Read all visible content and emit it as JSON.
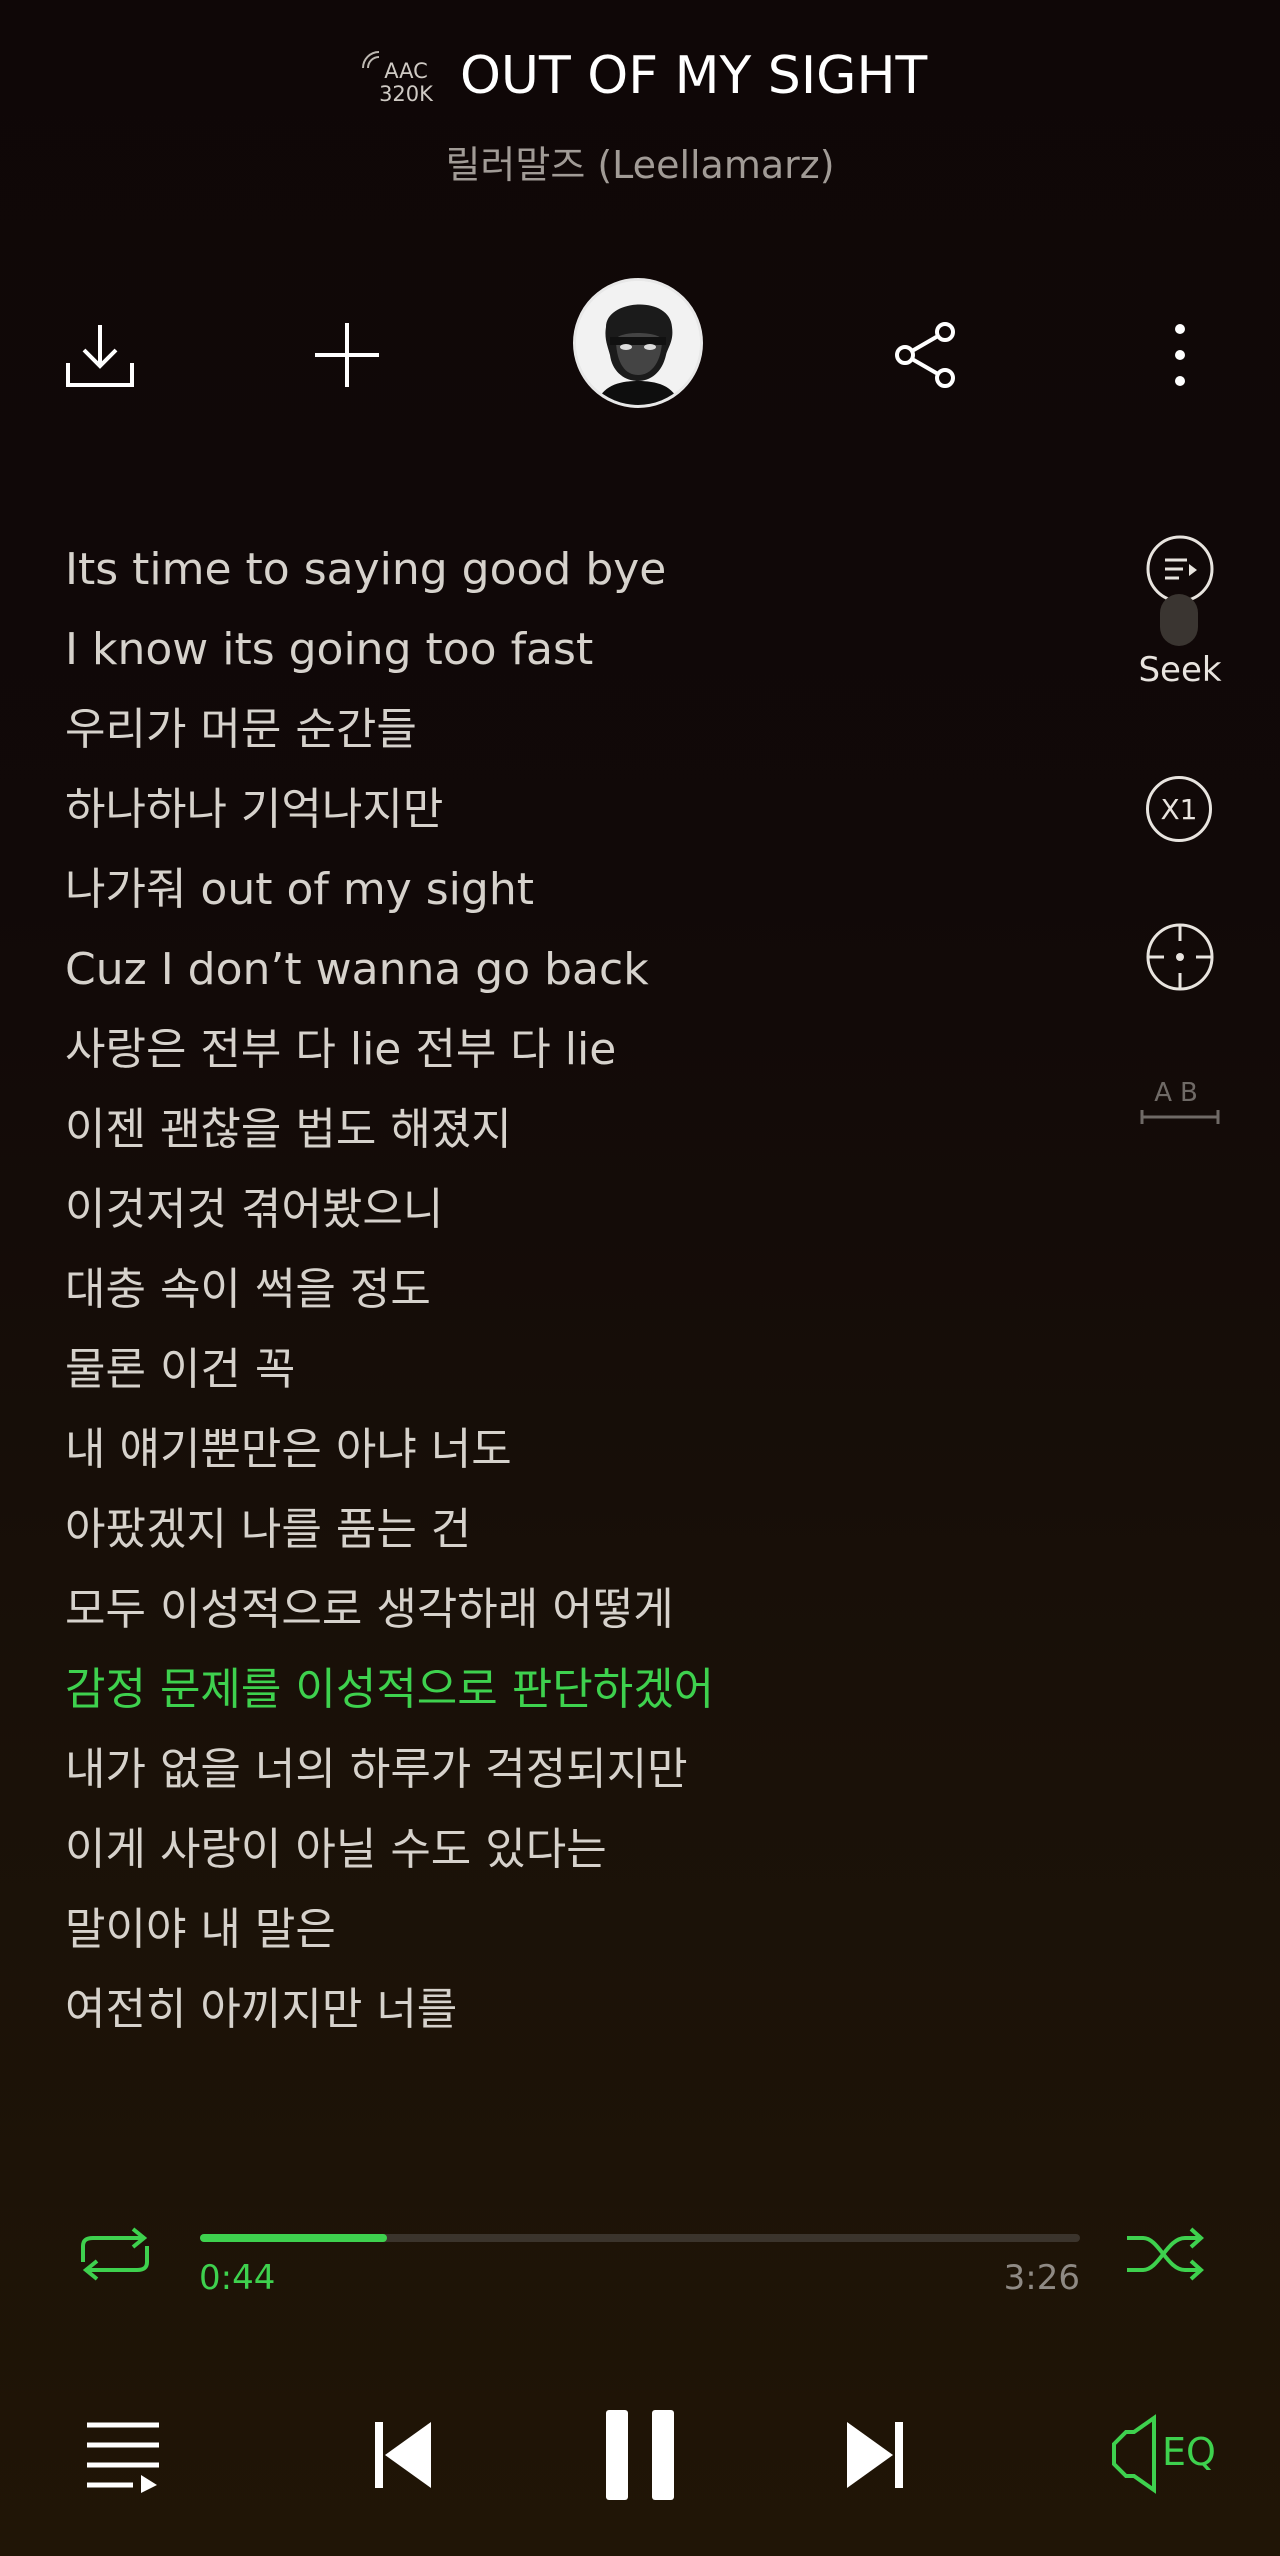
{
  "track": {
    "codec": "AAC",
    "bitrate": "320K",
    "title": "OUT OF MY SIGHT",
    "artist": "릴러말즈 (Leellamarz)"
  },
  "toolbar": {
    "download_icon": "download-icon",
    "add_icon": "plus-icon",
    "album_art": "album-art",
    "share_icon": "share-icon",
    "more_icon": "more-vertical-icon"
  },
  "lyrics": [
    "Its time to saying good bye",
    "I know its going too fast",
    "우리가 머문 순간들",
    "하나하나 기억나지만",
    "나가줘 out of my sight",
    "Cuz I don’t wanna go back",
    "사랑은 전부 다 lie 전부 다 lie",
    "이젠 괜찮을 법도 해졌지",
    "이것저것 겪어봤으니",
    "대충 속이 썩을 정도",
    "물론 이건 꼭",
    "내 얘기뿐만은 아냐 너도",
    "아팠겠지 나를 품는 건",
    "모두 이성적으로 생각하래 어떻게",
    "감정 문제를 이성적으로 판단하겠어",
    "내가 없을 너의 하루가 걱정되지만",
    "이게 사랑이 아닐 수도 있다는",
    "말이야 내 말은",
    "여전히 아끼지만 너를"
  ],
  "active_lyric_index": 14,
  "side_controls": {
    "seek_label": "Seek",
    "speed_label": "X1",
    "ab_label": "AB"
  },
  "playback": {
    "current_time": "0:44",
    "total_time": "3:26",
    "progress_fraction": 0.213,
    "eq_label": "EQ"
  },
  "colors": {
    "accent": "#3ed14e",
    "text": "#d6d2cc",
    "background_top": "#0f0707",
    "background_bottom": "#201506"
  }
}
